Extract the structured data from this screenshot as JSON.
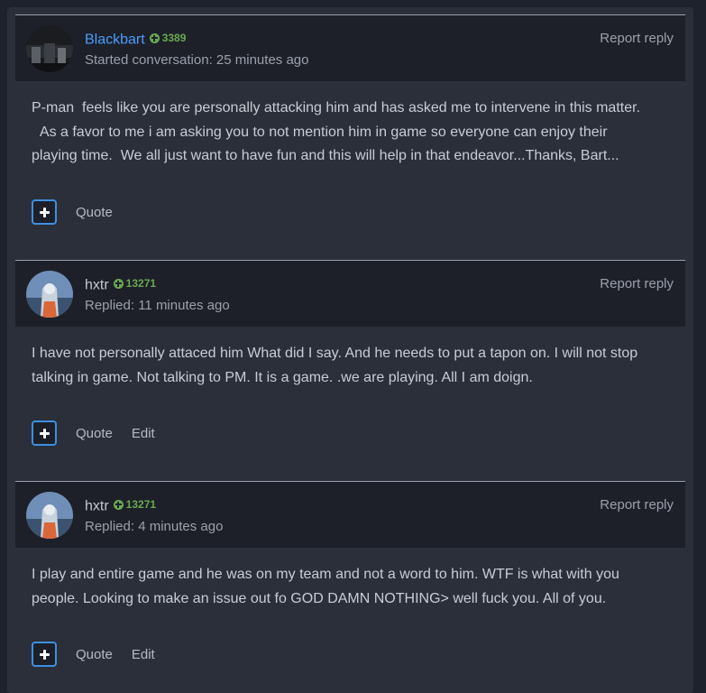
{
  "posts": [
    {
      "username": "Blackbart",
      "reputation": "3389",
      "meta": "Started conversation: 25 minutes ago",
      "report_label": "Report reply",
      "body": "P-man  feels like you are personally attacking him and has asked me to intervene in this matter.\n  As a favor to me i am asking you to not mention him in game so everyone can enjoy their\nplaying time.  We all just want to have fun and this will help in that endeavor...Thanks, Bart...",
      "actions": [
        "Quote"
      ]
    },
    {
      "username": "hxtr",
      "reputation": "13271",
      "meta": "Replied: 11 minutes ago",
      "report_label": "Report reply",
      "body": "I have not personally attaced him What did I say. And he needs to put a tapon on. I will not stop\ntalking in game. Not talking to PM. It is a game. .we are playing. All I am doign.",
      "actions": [
        "Quote",
        "Edit"
      ]
    },
    {
      "username": "hxtr",
      "reputation": "13271",
      "meta": "Replied: 4 minutes ago",
      "report_label": "Report reply",
      "body": "I play and entire game and he was on my team and not a word to him. WTF is what with you\npeople. Looking to make an issue out fo GOD DAMN NOTHING> well fuck you. All of you.",
      "actions": [
        "Quote",
        "Edit"
      ]
    }
  ],
  "colors": {
    "accent_username": "#4a9eff",
    "reputation_green": "#6aa84f",
    "plus_border": "#3f8fe0"
  },
  "icons": {
    "reputation": "plus-circle-icon",
    "multiquote": "plus-icon"
  }
}
